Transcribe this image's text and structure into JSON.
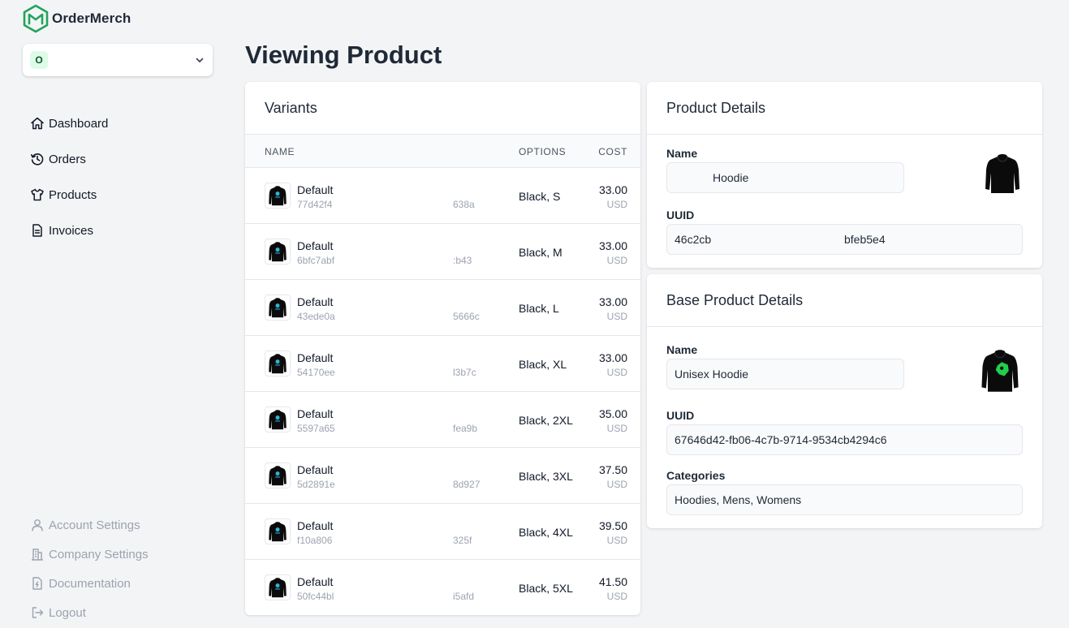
{
  "app": {
    "name": "OrderMerch"
  },
  "org_selector": {
    "avatar_letter": "O",
    "name": ""
  },
  "nav": {
    "items": [
      {
        "label": "Dashboard",
        "icon": "home-icon"
      },
      {
        "label": "Orders",
        "icon": "history-icon"
      },
      {
        "label": "Products",
        "icon": "shirt-icon"
      },
      {
        "label": "Invoices",
        "icon": "document-icon"
      }
    ]
  },
  "bottom_nav": {
    "items": [
      {
        "label": "Account Settings",
        "icon": "user-icon"
      },
      {
        "label": "Company Settings",
        "icon": "building-icon"
      },
      {
        "label": "Documentation",
        "icon": "file-bolt-icon"
      },
      {
        "label": "Logout",
        "icon": "logout-icon"
      }
    ]
  },
  "page": {
    "title": "Viewing Product"
  },
  "variants": {
    "title": "Variants",
    "columns": {
      "name": "NAME",
      "options": "OPTIONS",
      "cost": "COST"
    },
    "rows": [
      {
        "name": "Default",
        "id_start": "77d42f4",
        "id_end": "638a",
        "options": "Black, S",
        "cost": "33.00",
        "currency": "USD"
      },
      {
        "name": "Default",
        "id_start": "6bfc7abf",
        "id_end": ":b43",
        "options": "Black, M",
        "cost": "33.00",
        "currency": "USD"
      },
      {
        "name": "Default",
        "id_start": "43ede0a",
        "id_end": "5666c",
        "options": "Black, L",
        "cost": "33.00",
        "currency": "USD"
      },
      {
        "name": "Default",
        "id_start": "54170ee",
        "id_end": "l3b7c",
        "options": "Black, XL",
        "cost": "33.00",
        "currency": "USD"
      },
      {
        "name": "Default",
        "id_start": "5597a65",
        "id_end": "fea9b",
        "options": "Black, 2XL",
        "cost": "35.00",
        "currency": "USD"
      },
      {
        "name": "Default",
        "id_start": "5d2891e",
        "id_end": "8d927",
        "options": "Black, 3XL",
        "cost": "37.50",
        "currency": "USD"
      },
      {
        "name": "Default",
        "id_start": "f10a806",
        "id_end": "325f",
        "options": "Black, 4XL",
        "cost": "39.50",
        "currency": "USD"
      },
      {
        "name": "Default",
        "id_start": "50fc44bl",
        "id_end": "i5afd",
        "options": "Black, 5XL",
        "cost": "41.50",
        "currency": "USD"
      }
    ]
  },
  "product_details": {
    "title": "Product Details",
    "name_label": "Name",
    "name_value": "Hoodie",
    "uuid_label": "UUID",
    "uuid_start": "46c2cb",
    "uuid_end": "bfeb5e4"
  },
  "base_product_details": {
    "title": "Base Product Details",
    "name_label": "Name",
    "name_value": "Unisex Hoodie",
    "uuid_label": "UUID",
    "uuid_value": "67646d42-fb06-4c7b-9714-9534cb4294c6",
    "categories_label": "Categories",
    "categories_value": "Hoodies, Mens, Womens"
  },
  "colors": {
    "brand": "#22a35a",
    "accent_green": "#1fd14a",
    "print_blue": "#2fb4d8"
  }
}
